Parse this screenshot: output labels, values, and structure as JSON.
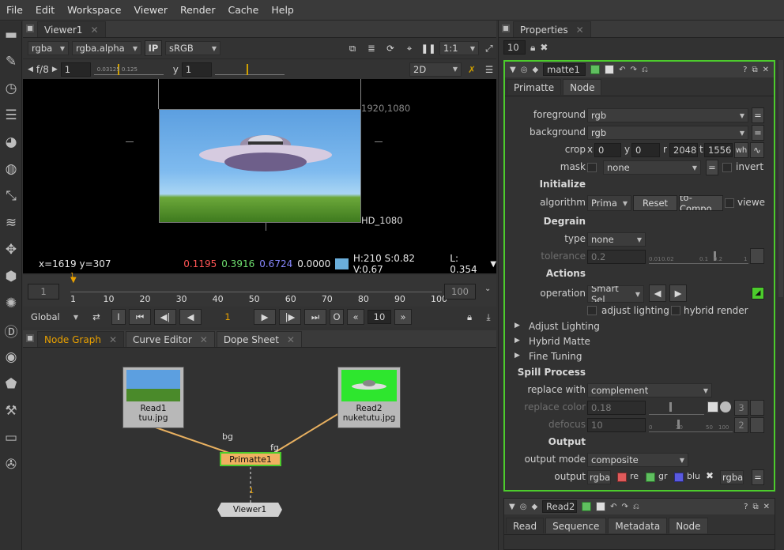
{
  "menu": [
    "File",
    "Edit",
    "Workspace",
    "Viewer",
    "Render",
    "Cache",
    "Help"
  ],
  "viewer": {
    "tab": "Viewer1",
    "channels": "rgba",
    "alpha": "rgba.alpha",
    "ip": "IP",
    "colorspace": "sRGB",
    "zoom": "1:1",
    "fstop": "f/8",
    "frame_val": "1",
    "y_label": "y",
    "y_val": "1",
    "gain_ticks": "0.03125 0.125",
    "view_mode": "2D",
    "res_label": "1920,1080",
    "format_label": "HD_1080",
    "info_coords": "x=1619 y=307",
    "info_r": "0.1195",
    "info_g": "0.3916",
    "info_b": "0.6724",
    "info_a": "0.0000",
    "info_hsv": "H:210 S:0.82 V:0.67",
    "info_l": "L: 0.354",
    "colors": {
      "r": "#ff5555",
      "g": "#6fe06f",
      "b": "#7777ff",
      "swatch": "#6aaedb"
    }
  },
  "timeline": {
    "start": "1",
    "end": "100",
    "ticks": [
      "1",
      "10",
      "20",
      "30",
      "40",
      "50",
      "60",
      "70",
      "80",
      "90",
      "100"
    ],
    "current_marker": "1",
    "mode": "Global",
    "current_frame": "1",
    "step": "10",
    "in_label": "I",
    "out_label": "O"
  },
  "nodegraph": {
    "tabs": [
      "Node Graph",
      "Curve Editor",
      "Dope Sheet"
    ],
    "read1": {
      "label": "Read1",
      "file": "tuu.jpg"
    },
    "read2": {
      "label": "Read2",
      "file": "nuketutu.jpg"
    },
    "primatte": "Primatte1",
    "viewer": "Viewer1",
    "bg_label": "bg",
    "fg_label": "fg",
    "pipe_label": "1"
  },
  "properties": {
    "tab": "Properties",
    "max_panels": "10",
    "node_name": "matte1",
    "subtabs": [
      "Primatte",
      "Node"
    ],
    "foreground": {
      "label": "foreground",
      "value": "rgb"
    },
    "background": {
      "label": "background",
      "value": "rgb"
    },
    "crop": {
      "label": "crop",
      "x": "0",
      "y": "0",
      "r": "2048",
      "t": "1556",
      "x_lbl": "x",
      "y_lbl": "y",
      "r_lbl": "r",
      "t_lbl": "t",
      "wh": "wh"
    },
    "mask": {
      "label": "mask",
      "value": "none",
      "invert": "invert"
    },
    "initialize": "Initialize",
    "algorithm": {
      "label": "algorithm",
      "value": "Prima",
      "reset": "Reset",
      "to_comp": "to-Compo",
      "viewer": "viewer"
    },
    "degrain": "Degrain",
    "type": {
      "label": "type",
      "value": "none"
    },
    "tolerance": {
      "label": "tolerance",
      "value": "0.2",
      "ticks": [
        "0.01",
        "0.02",
        "0.1",
        "0.2",
        "1"
      ]
    },
    "actions": "Actions",
    "operation": {
      "label": "operation",
      "value": "Smart Sel"
    },
    "adjust_lighting": "adjust lighting",
    "hybrid_render": "hybrid render",
    "collapsed": [
      "Adjust Lighting",
      "Hybrid Matte",
      "Fine Tuning"
    ],
    "spill": "Spill Process",
    "replace_with": {
      "label": "replace with",
      "value": "complement"
    },
    "replace_color": {
      "label": "replace color",
      "value": "0.18",
      "count": "3"
    },
    "defocus": {
      "label": "defocus",
      "value": "10",
      "ticks": [
        "0",
        "20",
        "50",
        "100"
      ],
      "count": "2"
    },
    "output_sect": "Output",
    "output_mode": {
      "label": "output mode",
      "value": "composite"
    },
    "output": {
      "label": "output",
      "value": "rgba",
      "r": "re",
      "g": "gr",
      "b": "blu",
      "a": "rgba"
    },
    "read2_panel": {
      "name": "Read2",
      "tabs": [
        "Read",
        "Sequence",
        "Metadata",
        "Node"
      ]
    }
  }
}
